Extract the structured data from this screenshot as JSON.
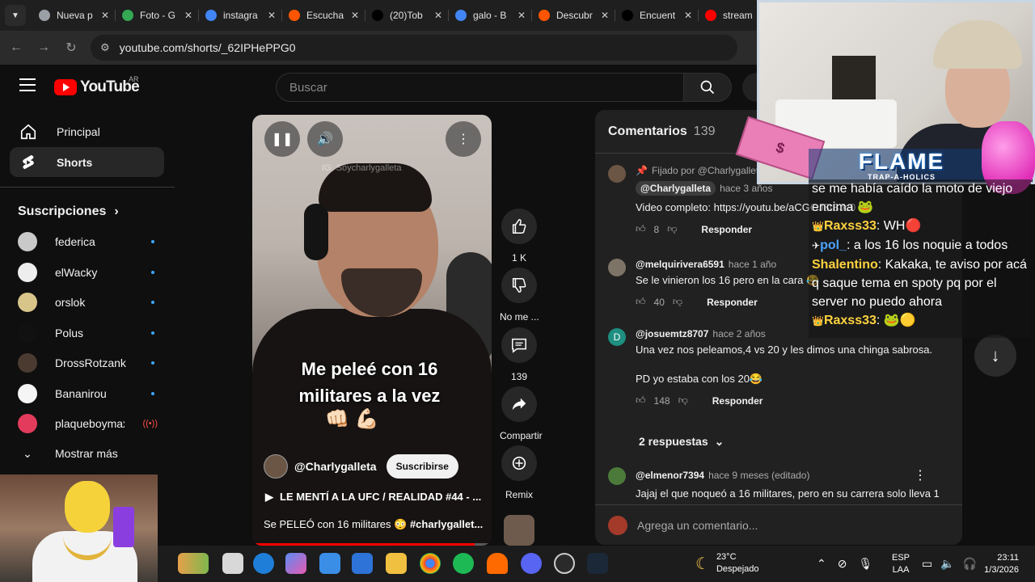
{
  "browser": {
    "tabs": [
      {
        "title": "Nueva p",
        "color": "#9aa0a6"
      },
      {
        "title": "Foto - G",
        "color": "#34a853"
      },
      {
        "title": "instagra",
        "color": "#4285f4"
      },
      {
        "title": "Escucha",
        "color": "#ff5500"
      },
      {
        "title": "(20)Tob",
        "color": "#000000"
      },
      {
        "title": "galo - B",
        "color": "#4285f4"
      },
      {
        "title": "Descubr",
        "color": "#ff5500"
      },
      {
        "title": "Encuent",
        "color": "#000000"
      },
      {
        "title": "stream",
        "color": "#ff0000"
      }
    ],
    "url": "youtube.com/shorts/_62IPHePPG0"
  },
  "youtube": {
    "logo_text": "YouTube",
    "country": "AR",
    "search_placeholder": "Buscar"
  },
  "sidebar": {
    "principal": "Principal",
    "shorts": "Shorts",
    "subscriptions_heading": "Suscripciones",
    "subscriptions": [
      {
        "name": "federica",
        "color": "#c9c9c9",
        "status": "new"
      },
      {
        "name": "elWacky",
        "color": "#eeeeee",
        "status": "new"
      },
      {
        "name": "orslok",
        "color": "#d8c58a",
        "status": "new"
      },
      {
        "name": "Polus",
        "color": "#111111",
        "status": "new"
      },
      {
        "name": "DrossRotzank",
        "color": "#4a3a30",
        "status": "new"
      },
      {
        "name": "Bananirou",
        "color": "#f5f5f5",
        "status": "new"
      },
      {
        "name": "plaqueboymax",
        "color": "#e23b5c",
        "status": "live"
      }
    ],
    "show_more": "Mostrar más"
  },
  "short": {
    "watermark": "IG: Soycharlygalleta",
    "caption": "Me peleé con 16 militares a la vez",
    "caption_emoji": "👊🏻 💪🏻",
    "channel": "@Charlygalleta",
    "subscribe": "Suscribirse",
    "playlist": "LE MENTÍ A LA UFC / REALIDAD #44 - ...",
    "description": "Se PELEÓ con 16 militares 😳",
    "hashtag": "#charlygallet...",
    "progress": 0.93
  },
  "actions": {
    "likes": "1 K",
    "dislike": "No me ...",
    "comments": "139",
    "share": "Compartir",
    "remix": "Remix"
  },
  "comments_panel": {
    "title": "Comentarios",
    "count": "139",
    "comments": [
      {
        "pinned": "Fijado por @Charlygalleta",
        "author": "@Charlygalleta",
        "time": "hace 3 años",
        "text": "Video completo: https://youtu.be/aCGGJ8tBJc0",
        "likes": "8",
        "reply": "Responder",
        "color": "#6b5646"
      },
      {
        "author": "@melquirivera6591",
        "time": "hace 1 año",
        "text": "Se le vinieron los 16 pero en la cara 😂",
        "likes": "40",
        "reply": "Responder",
        "color": "#7d7467"
      },
      {
        "author": "@josuemtz8707",
        "time": "hace 2 años",
        "initial": "D",
        "text": "Una vez nos peleamos,4 vs 20 y les dimos una chinga sabrosa.",
        "text2": "PD yo estaba con los 20😂",
        "likes": "148",
        "reply": "Responder",
        "color": "#1e8f80"
      },
      {
        "author": "@elmenor7394",
        "time": "hace 9 meses (editado)",
        "text": "Jajaj el que noqueó a 16 militares, pero en su carrera solo lleva 1",
        "color": "#4c7a3a"
      }
    ],
    "replies": "2 respuestas",
    "add_placeholder": "Agrega un comentario..."
  },
  "stream": {
    "banner_title": "FLAME",
    "banner_sub": "TRAP-A-HOLICS",
    "chat": [
      {
        "user": "",
        "text": "se me había caído la moto de viejo encima 🐸"
      },
      {
        "user": "Raxss33",
        "text": "WH🔴",
        "badge": "👑",
        "color": "#ffd23f"
      },
      {
        "user": "pol_",
        "text": "a los 16 los noquie a todos",
        "badge": "✈",
        "color": "#4ba3ff"
      },
      {
        "user": "Shalentino",
        "text": "Kakaka, te aviso por acá q saque tema en spoty pq por el server no puedo ahora",
        "color": "#ffd23f"
      },
      {
        "user": "Raxss33",
        "text": "🐸🟡",
        "badge": "👑",
        "color": "#ffd23f"
      }
    ]
  },
  "taskbar": {
    "temp": "23°C",
    "weather": "Despejado",
    "lang1": "ESP",
    "lang2": "LAA",
    "time": "23:11",
    "date": "1/3/2026"
  }
}
